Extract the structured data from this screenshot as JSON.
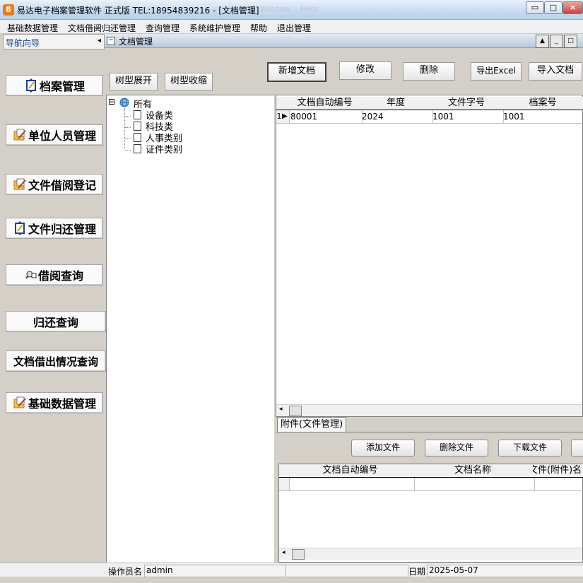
{
  "window": {
    "title": "易达电子档案管理软件 正式版 TEL:18954839216  - [文档管理]",
    "app_icon": "8",
    "ghost_menu": [
      "Window",
      "Help"
    ],
    "controls": {
      "minimize": "▭",
      "maximize": "□",
      "close": "×"
    }
  },
  "menu": [
    "基础数据管理",
    "文档借阅归还管理",
    "查询管理",
    "系统维护管理",
    "帮助",
    "退出管理"
  ],
  "nav": {
    "title": "导航向导",
    "arrow": "◂",
    "items": [
      {
        "label": "档案管理",
        "icon": "archive-arrows-icon"
      },
      {
        "label": "单位人员管理",
        "icon": "folder-edit-icon"
      },
      {
        "label": "文件借阅登记",
        "icon": "folder-edit-icon"
      },
      {
        "label": "文件归还管理",
        "icon": "archive-arrows-icon"
      },
      {
        "label": "借阅查询",
        "icon": "search-person-icon"
      },
      {
        "label": "归还查询",
        "icon": ""
      },
      {
        "label": "文档借出情况查询",
        "icon": ""
      },
      {
        "label": "基础数据管理",
        "icon": "folder-edit-icon"
      }
    ]
  },
  "doc_panel": {
    "title": "文档管理",
    "collapse_glyph": "−"
  },
  "sys_buttons": [
    "▲",
    "_",
    "□"
  ],
  "toolbar": {
    "expand": "树型展开",
    "collapse": "树型收缩",
    "add": "新增文档",
    "edit": "修改",
    "delete": "删除",
    "export": "导出Excel",
    "import": "导入文档"
  },
  "tree": {
    "root_toggle": "⊟",
    "root": "所有",
    "children": [
      "设备类",
      "科技类",
      "人事类别",
      "证件类别"
    ]
  },
  "grid": {
    "columns": [
      "文档自动编号",
      "年度",
      "文件字号",
      "档案号"
    ],
    "rows": [
      {
        "index": "1",
        "marker": "▶",
        "cells": [
          "80001",
          "2024",
          "1001",
          "1001"
        ]
      }
    ]
  },
  "scroll_arrow": "◂",
  "attachments": {
    "tab": "附件(文件管理)",
    "buttons": [
      "添加文件",
      "删除文件",
      "下载文件"
    ],
    "columns": [
      "文档自动编号",
      "文档名称",
      "文件(附件)名"
    ]
  },
  "status": {
    "operator_label": "操作员名",
    "operator": "admin",
    "date_label": "日期",
    "date": "2025-05-07"
  }
}
